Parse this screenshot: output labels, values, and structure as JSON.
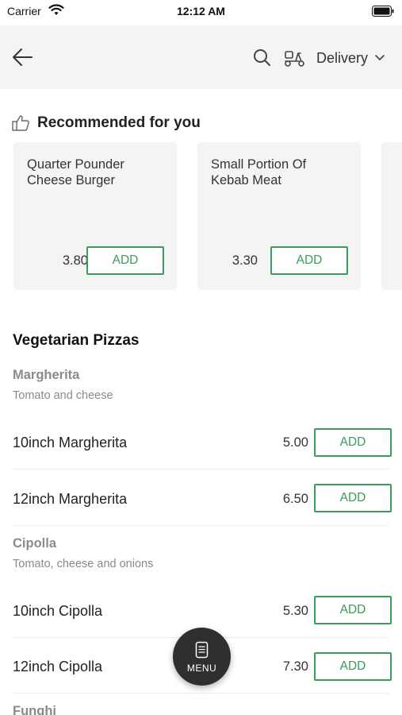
{
  "status_bar": {
    "carrier": "Carrier",
    "time": "12:12 AM"
  },
  "header": {
    "delivery_label": "Delivery"
  },
  "recommended": {
    "title": "Recommended for you",
    "cards": [
      {
        "name": "Quarter Pounder Cheese Burger",
        "price": "3.80",
        "add_label": "ADD"
      },
      {
        "name": "Small Portion Of Kebab Meat",
        "price": "3.30",
        "add_label": "ADD"
      }
    ]
  },
  "section": {
    "title": "Vegetarian Pizzas",
    "groups": [
      {
        "name": "Margherita",
        "description": "Tomato and cheese",
        "items": [
          {
            "name": "10inch Margherita",
            "price": "5.00",
            "add_label": "ADD"
          },
          {
            "name": "12inch Margherita",
            "price": "6.50",
            "add_label": "ADD"
          }
        ]
      },
      {
        "name": "Cipolla",
        "description": "Tomato, cheese and onions",
        "items": [
          {
            "name": "10inch Cipolla",
            "price": "5.30",
            "add_label": "ADD"
          },
          {
            "name": "12inch Cipolla",
            "price": "7.30",
            "add_label": "ADD"
          }
        ]
      },
      {
        "name": "Funghi"
      }
    ]
  },
  "fab": {
    "label": "MENU"
  },
  "colors": {
    "accent": "#3a9c5a",
    "header_bg": "#f4f4f4",
    "fab_bg": "#2f2f2f"
  }
}
